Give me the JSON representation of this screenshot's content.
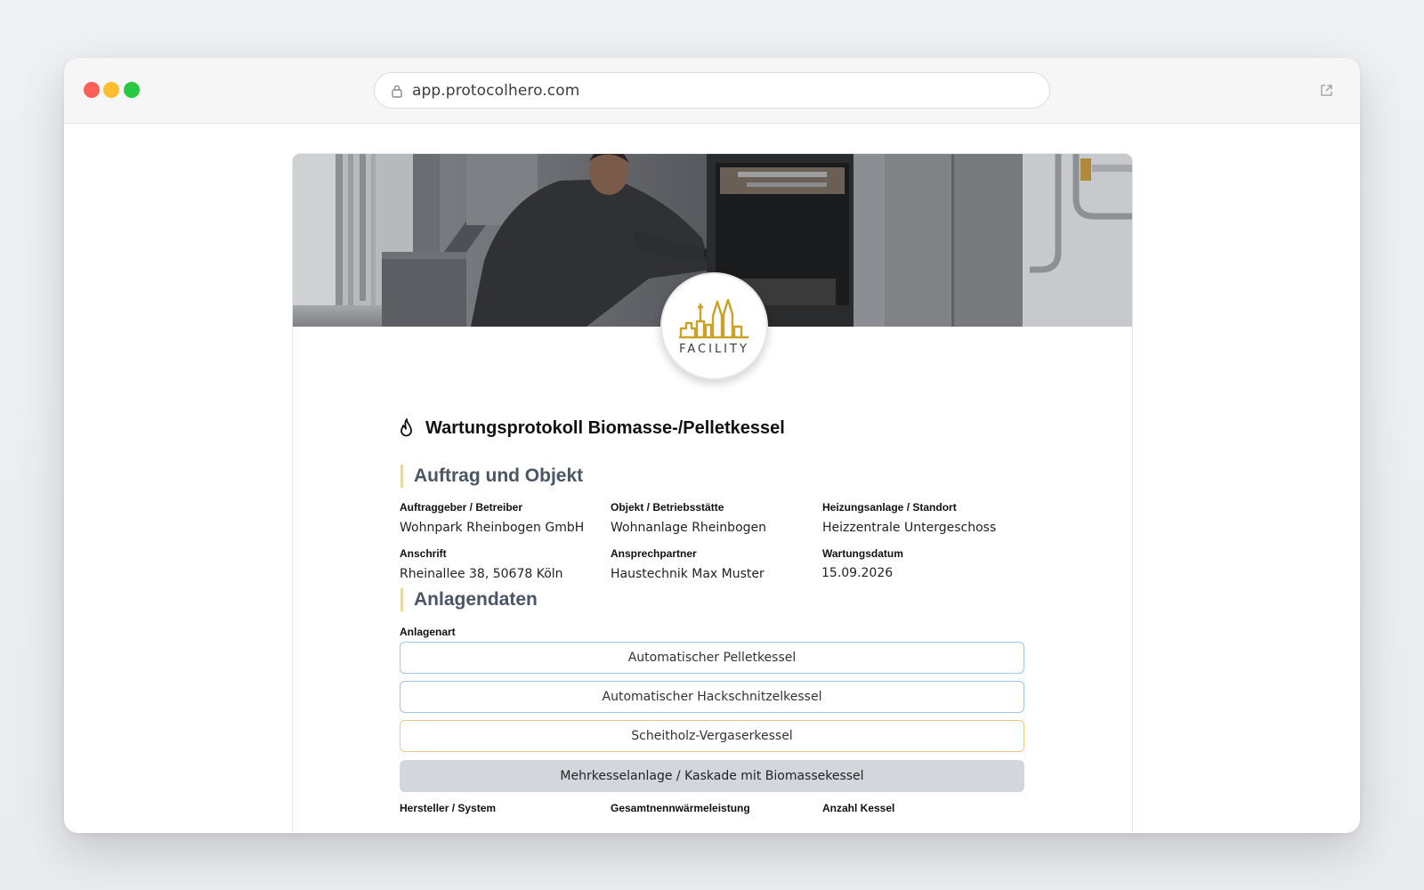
{
  "browser": {
    "url": "app.protocolhero.com"
  },
  "logo": {
    "text": "FACILITY"
  },
  "form": {
    "title": "Wartungsprotokoll Biomasse-/Pelletkessel",
    "section1": {
      "title": "Auftrag und Objekt",
      "fields": [
        {
          "label": "Auftraggeber / Betreiber",
          "value": "Wohnpark Rheinbogen GmbH"
        },
        {
          "label": "Objekt / Betriebsstätte",
          "value": "Wohnanlage Rheinbogen"
        },
        {
          "label": "Heizungsanlage / Standort",
          "value": "Heizzentrale Untergeschoss"
        },
        {
          "label": "Anschrift",
          "value": "Rheinallee 38, 50678 Köln"
        },
        {
          "label": "Ansprechpartner",
          "value": "Haustechnik Max Muster"
        },
        {
          "label": "Wartungsdatum",
          "value": "15.09.2026"
        }
      ]
    },
    "section2": {
      "title": "Anlagendaten",
      "anlagenart_label": "Anlagenart",
      "options": [
        {
          "label": "Automatischer Pelletkessel"
        },
        {
          "label": "Automatischer Hackschnitzelkessel"
        },
        {
          "label": "Scheitholz-Vergaserkessel"
        },
        {
          "label": "Mehrkesselanlage / Kaskade mit Biomassekessel"
        }
      ],
      "selected_option": "Mehrkesselanlage / Kaskade mit Biomassekessel",
      "bottom_labels": [
        "Hersteller / System",
        "Gesamtnennwärmeleistung",
        "Anzahl Kessel"
      ]
    }
  },
  "colors": {
    "accent_gold": "#c9a227",
    "option_blue_border": "#9ec5ea",
    "option_orange_border": "#f1c88a",
    "selected_bg": "#d3d7dd",
    "section_bar": "#e9d7a0"
  }
}
